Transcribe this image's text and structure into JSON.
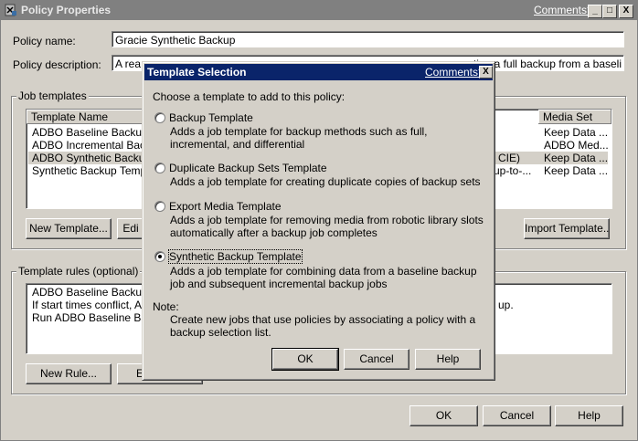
{
  "window": {
    "title": "Policy Properties",
    "comments_link": "Comments?",
    "minimize": "_",
    "maximize": "□",
    "close": "X"
  },
  "policy": {
    "name_label": "Policy name:",
    "name_value": "Gracie Synthetic Backup",
    "description_label": "Policy description:",
    "description_value_left": "A rea",
    "description_value_right": "ting a full backup from a baseli"
  },
  "job_templates": {
    "group_label": "Job templates",
    "columns": [
      "Template Name",
      "Media Set"
    ],
    "rows": [
      {
        "name": "ADBO Baseline Backup",
        "mid": "",
        "media": "Keep Data ..."
      },
      {
        "name": "ADBO Incremental Back...",
        "mid": "",
        "media": "ADBO Med..."
      },
      {
        "name": "ADBO Synthetic Backup",
        "mid": "CIE)",
        "media": "Keep Data ..."
      },
      {
        "name": "Synthetic Backup Templ...",
        "mid": "up-to-...",
        "media": "Keep Data ..."
      }
    ],
    "new_button": "New Template...",
    "edit_button": "Edi",
    "import_button": "Import Template..."
  },
  "template_rules": {
    "group_label": "Template rules (optional)",
    "rows": [
      {
        "left": "ADBO Baseline Backup r",
        "right": ""
      },
      {
        "left": "If start times conflict, ADB",
        "right": "up."
      },
      {
        "left": "Run ADBO Baseline Bac",
        "right": ""
      }
    ],
    "new_rule_button": "New Rule...",
    "edit_button": "E"
  },
  "footer": {
    "ok": "OK",
    "cancel": "Cancel",
    "help": "Help"
  },
  "dialog": {
    "title": "Template Selection",
    "comments_link": "Comments?",
    "close": "X",
    "prompt": "Choose a template to add to this policy:",
    "options": [
      {
        "label": "Backup Template",
        "desc": "Adds a job template for backup methods such as full, incremental, and differential",
        "checked": false
      },
      {
        "label": "Duplicate Backup Sets Template",
        "desc": "Adds a job template for creating duplicate copies of backup sets",
        "checked": false
      },
      {
        "label": "Export Media Template",
        "desc": "Adds a job template for removing media from robotic library slots automatically after a backup job completes",
        "checked": false
      },
      {
        "label": "Synthetic Backup Template",
        "desc": "Adds a job template for combining data from a baseline backup job and subsequent incremental backup jobs",
        "checked": true
      }
    ],
    "note_label": "Note:",
    "note_text": "Create new jobs that use policies by associating a policy with a backup selection list.",
    "ok": "OK",
    "cancel": "Cancel",
    "help": "Help"
  }
}
